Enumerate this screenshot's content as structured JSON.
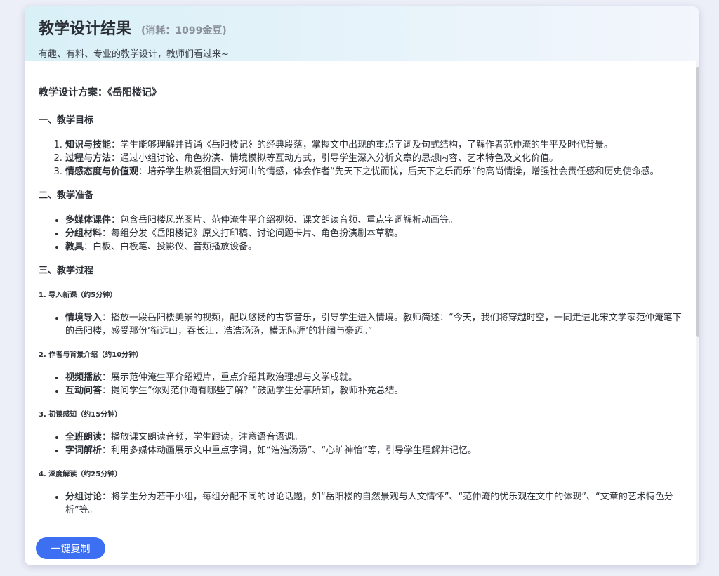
{
  "header": {
    "title": "教学设计结果",
    "cost": "(消耗：1099金豆)",
    "subtitle": "有趣、有料、专业的教学设计，教师们看过来~"
  },
  "plan_title": "教学设计方案：《岳阳楼记》",
  "sections": {
    "goals": {
      "heading": "一、教学目标",
      "items": [
        {
          "label": "知识与技能",
          "text": "：学生能够理解并背诵《岳阳楼记》的经典段落，掌握文中出现的重点字词及句式结构，了解作者范仲淹的生平及时代背景。"
        },
        {
          "label": "过程与方法",
          "text": "：通过小组讨论、角色扮演、情境模拟等互动方式，引导学生深入分析文章的思想内容、艺术特色及文化价值。"
        },
        {
          "label": "情感态度与价值观",
          "text": "：培养学生热爱祖国大好河山的情感，体会作者“先天下之忧而忧，后天下之乐而乐”的高尚情操，增强社会责任感和历史使命感。"
        }
      ]
    },
    "prep": {
      "heading": "二、教学准备",
      "items": [
        {
          "label": "多媒体课件",
          "text": "：包含岳阳楼风光图片、范仲淹生平介绍视频、课文朗读音频、重点字词解析动画等。"
        },
        {
          "label": "分组材料",
          "text": "：每组分发《岳阳楼记》原文打印稿、讨论问题卡片、角色扮演剧本草稿。"
        },
        {
          "label": "教具",
          "text": "：白板、白板笔、投影仪、音频播放设备。"
        }
      ]
    },
    "process": {
      "heading": "三、教学过程",
      "steps": [
        {
          "title": "1. 导入新课（约5分钟）",
          "items": [
            {
              "label": "情境导入",
              "text": "：播放一段岳阳楼美景的视频，配以悠扬的古筝音乐，引导学生进入情境。教师简述：“今天，我们将穿越时空，一同走进北宋文学家范仲淹笔下的岳阳楼，感受那份‘衔远山，吞长江，浩浩汤汤，横无际涯’的壮阔与豪迈。”"
            }
          ]
        },
        {
          "title": "2. 作者与背景介绍（约10分钟）",
          "items": [
            {
              "label": "视频播放",
              "text": "：展示范仲淹生平介绍短片，重点介绍其政治理想与文学成就。"
            },
            {
              "label": "互动问答",
              "text": "：提问学生“你对范仲淹有哪些了解？”鼓励学生分享所知，教师补充总结。"
            }
          ]
        },
        {
          "title": "3. 初读感知（约15分钟）",
          "items": [
            {
              "label": "全班朗读",
              "text": "：播放课文朗读音频，学生跟读，注意语音语调。"
            },
            {
              "label": "字词解析",
              "text": "：利用多媒体动画展示文中重点字词，如“浩浩汤汤”、“心旷神怡”等，引导学生理解并记忆。"
            }
          ]
        },
        {
          "title": "4. 深度解读（约25分钟）",
          "items": [
            {
              "label": "分组讨论",
              "text": "：将学生分为若干小组，每组分配不同的讨论话题，如“岳阳楼的自然景观与人文情怀”、“范仲淹的忧乐观在文中的体现”、“文章的艺术特色分析”等。"
            }
          ]
        }
      ]
    }
  },
  "copy_button": {
    "label": "一键复制"
  },
  "colors": {
    "accent": "#3d6ff3",
    "header_gradient_start": "#d9f0f7",
    "page_bg": "#eceef8"
  }
}
